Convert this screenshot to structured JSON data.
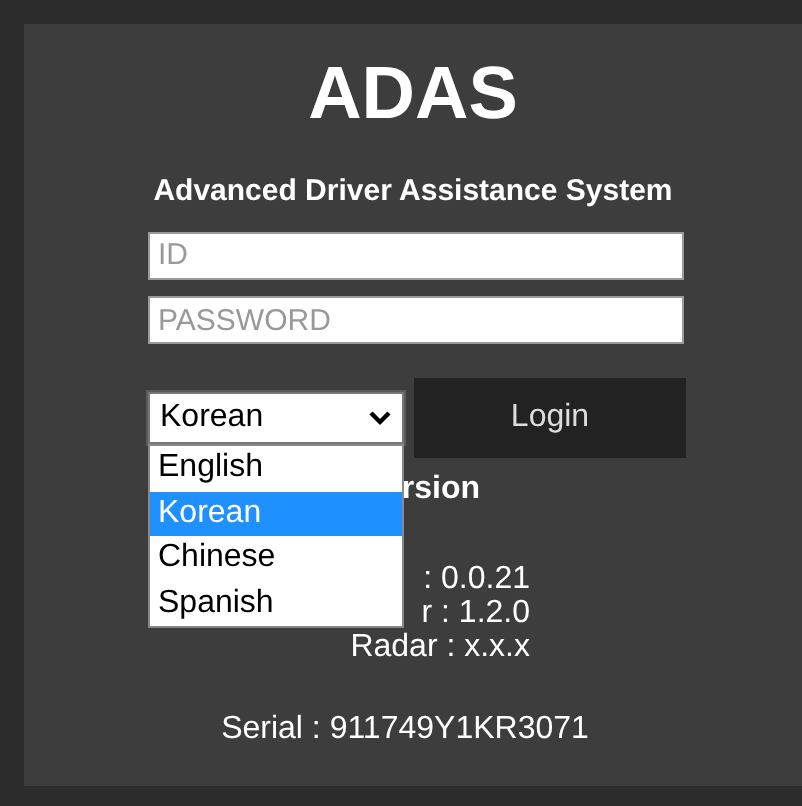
{
  "title": "ADAS",
  "subtitle": "Advanced Driver Assistance System",
  "fields": [
    {
      "placeholder": "ID"
    },
    {
      "placeholder": "PASSWORD"
    }
  ],
  "language_select": {
    "value": "Korean",
    "expanded": true,
    "options": [
      {
        "label": "English",
        "selected": false
      },
      {
        "label": "Korean",
        "selected": true
      },
      {
        "label": "Chinese",
        "selected": false
      },
      {
        "label": "Spanish",
        "selected": false
      }
    ]
  },
  "login_button": "Login",
  "version": {
    "heading": "rsion",
    "lines": [
      ": 0.0.21",
      "r : 1.2.0",
      "Radar : x.x.x"
    ]
  },
  "serial": "Serial : 911749Y1KR3071"
}
